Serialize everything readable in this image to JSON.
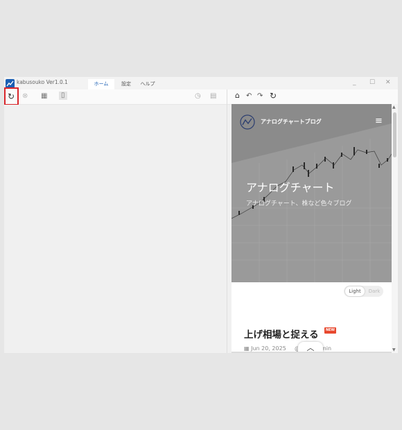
{
  "app": {
    "title": "kabusouko Ver1.0.1"
  },
  "menu": {
    "tabs": [
      "ホーム",
      "設定",
      "ヘルプ"
    ]
  },
  "window_controls": {
    "minimize": "_",
    "maximize": "☐",
    "close": "✕"
  },
  "toolbar": {
    "reload_icon": "↻",
    "stop_icon": "⊗",
    "table_icon": "▦",
    "file_icon": "▯",
    "timer_icon": "◷",
    "doc_icon": "▤"
  },
  "browser": {
    "home_icon": "⌂",
    "undo_icon": "↶",
    "redo_icon": "↷",
    "reload_icon": "↻"
  },
  "site": {
    "brand": "アナログチャートブログ",
    "menu_icon": "≡",
    "hero_title": "アナログチャート",
    "hero_subtitle": "アナログチャート、株など色々ブログ",
    "theme_light": "Light",
    "theme_dark": "Dark",
    "post_title": "上げ相場と捉える",
    "badge": "NEW",
    "post_date": "Jun 20, 2025",
    "post_extra": "@",
    "post_min": "min",
    "scroll_top_icon": "︿"
  },
  "colors": {
    "accent": "#1a5fb4",
    "highlight_border": "#d9252a",
    "badge": "#e8482e",
    "hero_bg": "#9a9a9a"
  }
}
